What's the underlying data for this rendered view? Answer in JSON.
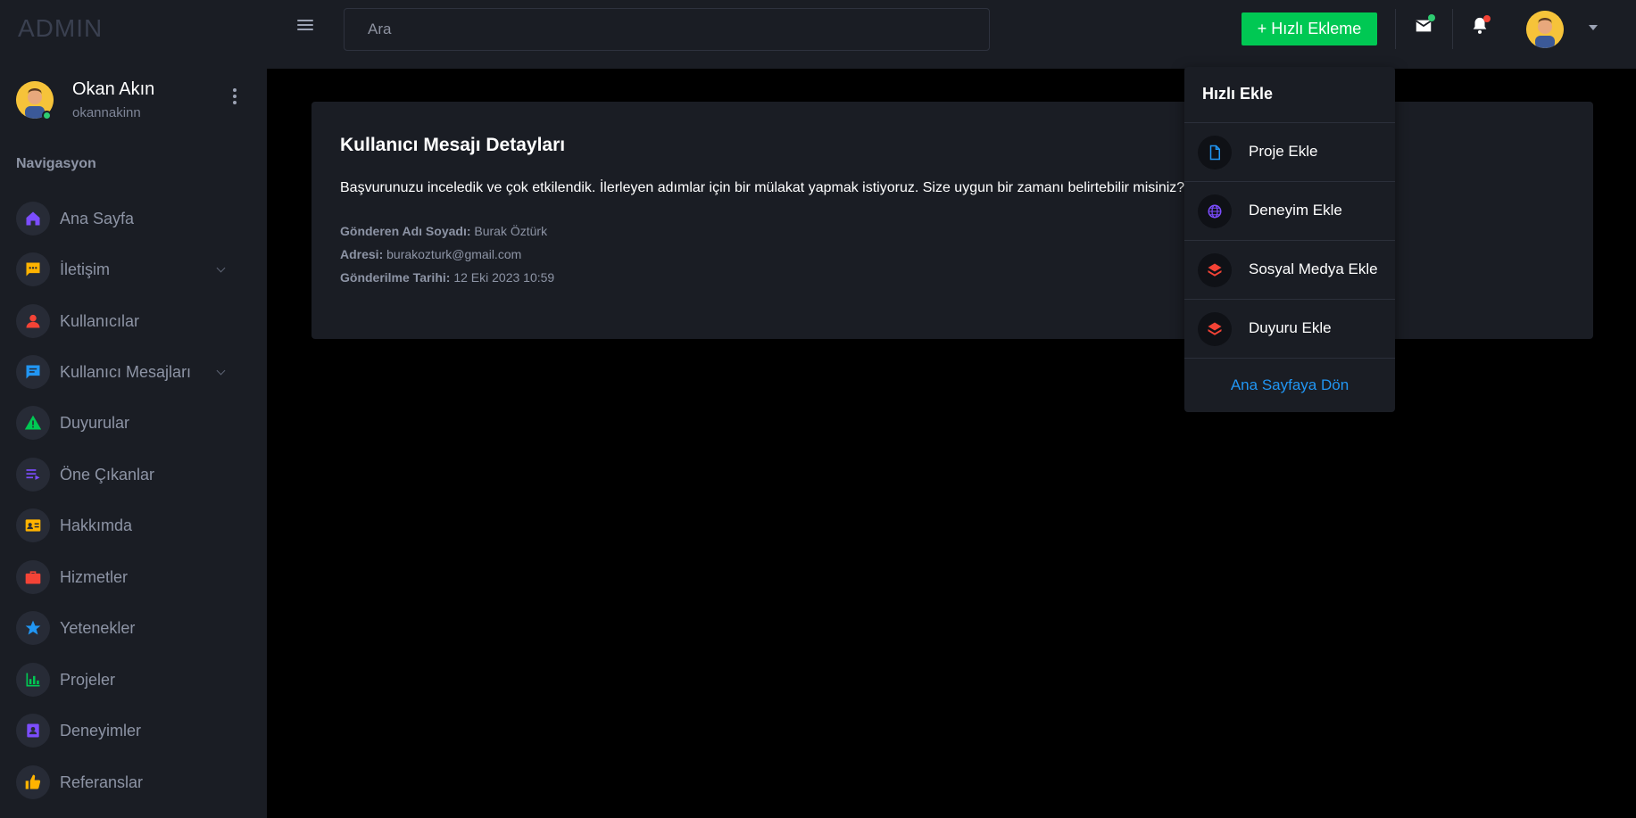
{
  "app": {
    "logo": "ADMIN"
  },
  "topbar": {
    "search_placeholder": "Ara",
    "quick_add_label": "+ Hızlı Ekleme",
    "colors": {
      "quick_add": "#00c853",
      "mail_dot": "#2ecc71",
      "bell_dot": "#f44336"
    },
    "icons": [
      "menu-icon",
      "mail-icon",
      "bell-icon",
      "avatar",
      "caret-down-icon"
    ]
  },
  "sidebar": {
    "user": {
      "name": "Okan Akın",
      "handle": "okannakinn"
    },
    "nav_title": "Navigasyon",
    "items": [
      {
        "label": "Ana Sayfa",
        "icon": "home-icon",
        "color": "#7c4dff"
      },
      {
        "label": "İletişim",
        "icon": "chat-icon",
        "color": "#ffb300"
      },
      {
        "label": "Kullanıcılar",
        "icon": "person-icon",
        "color": "#f44336"
      },
      {
        "label": "Kullanıcı Mesajları",
        "icon": "message-icon",
        "color": "#2196f3"
      },
      {
        "label": "Duyurular",
        "icon": "warning-icon",
        "color": "#00c853"
      },
      {
        "label": "Öne Çıkanlar",
        "icon": "playlist-icon",
        "color": "#7c4dff"
      },
      {
        "label": "Hakkımda",
        "icon": "id-card-icon",
        "color": "#ffb300"
      },
      {
        "label": "Hizmetler",
        "icon": "briefcase-icon",
        "color": "#f44336"
      },
      {
        "label": "Yetenekler",
        "icon": "star-icon",
        "color": "#2196f3"
      },
      {
        "label": "Projeler",
        "icon": "bar-chart-icon",
        "color": "#00c853"
      },
      {
        "label": "Deneyimler",
        "icon": "contact-book-icon",
        "color": "#7c4dff"
      },
      {
        "label": "Referanslar",
        "icon": "thumbs-up-icon",
        "color": "#ffb300"
      }
    ]
  },
  "main": {
    "title": "Kullanıcı Mesajı Detayları",
    "message": "Başvurunuzu inceledik ve çok etkilendik. İlerleyen adımlar için bir mülakat yapmak istiyoruz. Size uygun bir zamanı belirtebilir misiniz? Saygılarımla,",
    "sender_label": "Gönderen Adı Soyadı:",
    "sender_value": "Burak Öztürk",
    "address_label": "Adresi:",
    "address_value": "burakozturk@gmail.com",
    "date_label": "Gönderilme Tarihi:",
    "date_value": "12 Eki 2023 10:59"
  },
  "quick_add_menu": {
    "title": "Hızlı Ekle",
    "items": [
      {
        "label": "Proje Ekle",
        "icon": "file-icon",
        "color": "#2196f3"
      },
      {
        "label": "Deneyim Ekle",
        "icon": "globe-icon",
        "color": "#7c4dff"
      },
      {
        "label": "Sosyal Medya Ekle",
        "icon": "layers-icon",
        "color": "#f44336"
      },
      {
        "label": "Duyuru Ekle",
        "icon": "layers-icon",
        "color": "#f44336"
      }
    ],
    "footer_link": "Ana Sayfaya Dön"
  }
}
